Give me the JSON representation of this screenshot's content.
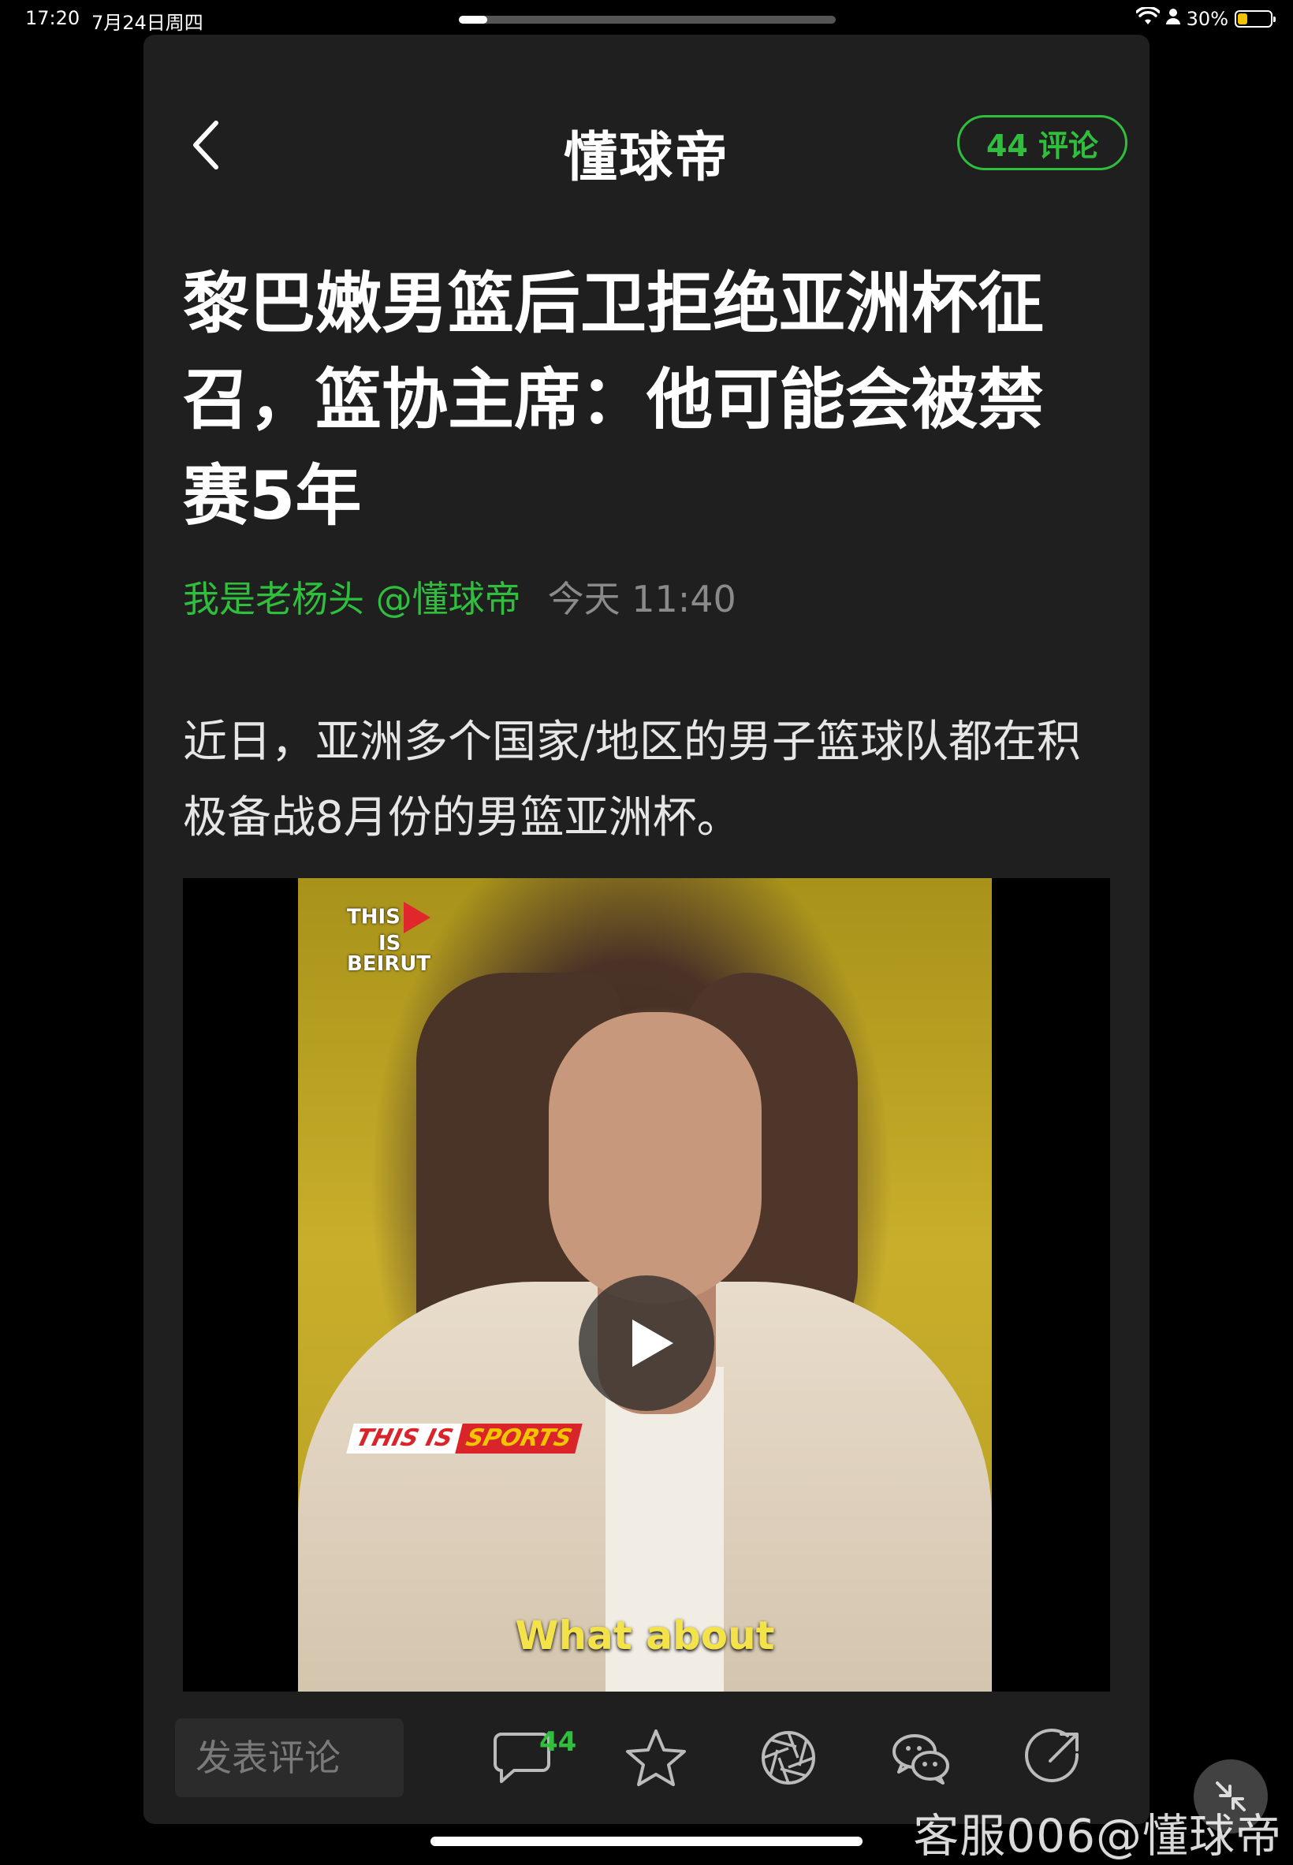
{
  "status_bar": {
    "time": "17:20",
    "date": "7月24日周四",
    "battery_text": "30%",
    "battery_level": 0.3
  },
  "header": {
    "app_name": "懂球帝",
    "comments_pill": "44 评论"
  },
  "article": {
    "title": "黎巴嫩男篮后卫拒绝亚洲杯征召，篮协主席：他可能会被禁赛5年",
    "author": "我是老杨头 @懂球帝",
    "publish_time": "今天 11:40",
    "body": "近日，亚洲多个国家/地区的男子篮球队都在积极备战8月份的男篮亚洲杯。"
  },
  "video": {
    "logo_line1": "THIS",
    "logo_line2": "IS",
    "logo_line3": "BEIRUT",
    "tag_part1": "THIS IS",
    "tag_part2": "SPORTS",
    "subtitle": "What about"
  },
  "toolbar": {
    "comment_placeholder": "发表评论",
    "comment_count": "44"
  },
  "watermark": "客服006@懂球帝",
  "colors": {
    "accent": "#2fbf3d",
    "panel_bg": "#1f1f1f",
    "page_bg": "#000000"
  },
  "icons": {
    "back": "chevron-left-icon",
    "comments": "speech-bubble-icon",
    "favorite": "star-icon",
    "moments": "camera-shutter-icon",
    "wechat": "wechat-icon",
    "share": "share-arrow-icon"
  }
}
